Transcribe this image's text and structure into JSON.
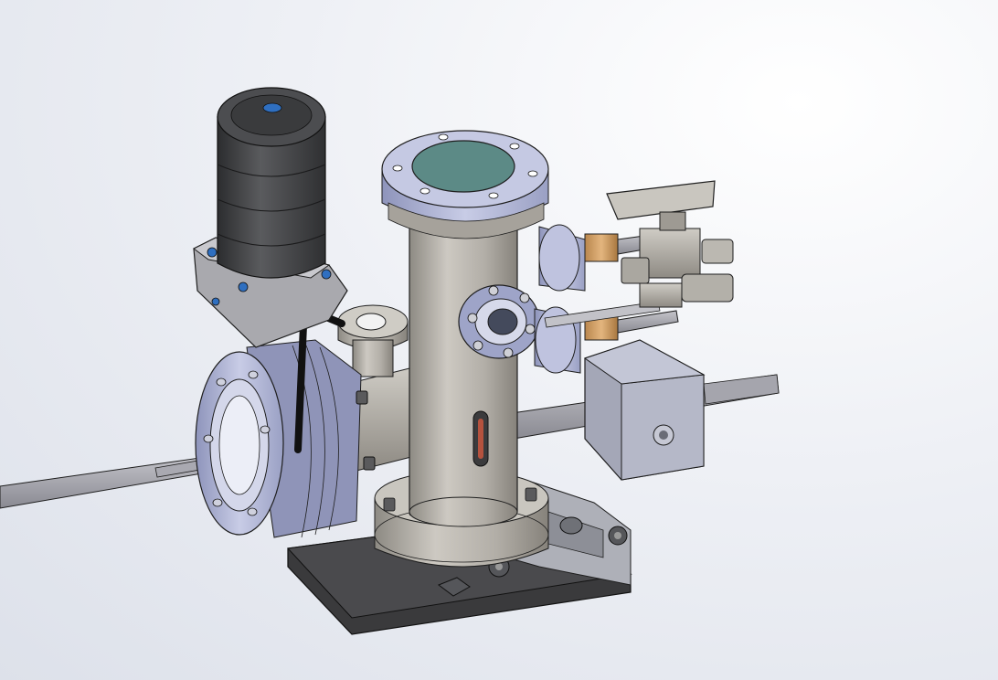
{
  "scene": {
    "name": "vacuum-chamber-assembly",
    "background_colors": [
      "#ffffff",
      "#e6e9f0",
      "#d9dde6"
    ],
    "part_colors": {
      "steel": "#b7b4ad",
      "steel_dark": "#8f8b84",
      "flange_blue": "#b9bdd9",
      "flange_blue_dark": "#9aa0c4",
      "bellows_dark": "#3e3f41",
      "base_plate": "#3a3a3c",
      "window_teal": "#5c8a86",
      "copper_gasket": "#d4a46c",
      "outline": "#1e1e1e"
    }
  }
}
